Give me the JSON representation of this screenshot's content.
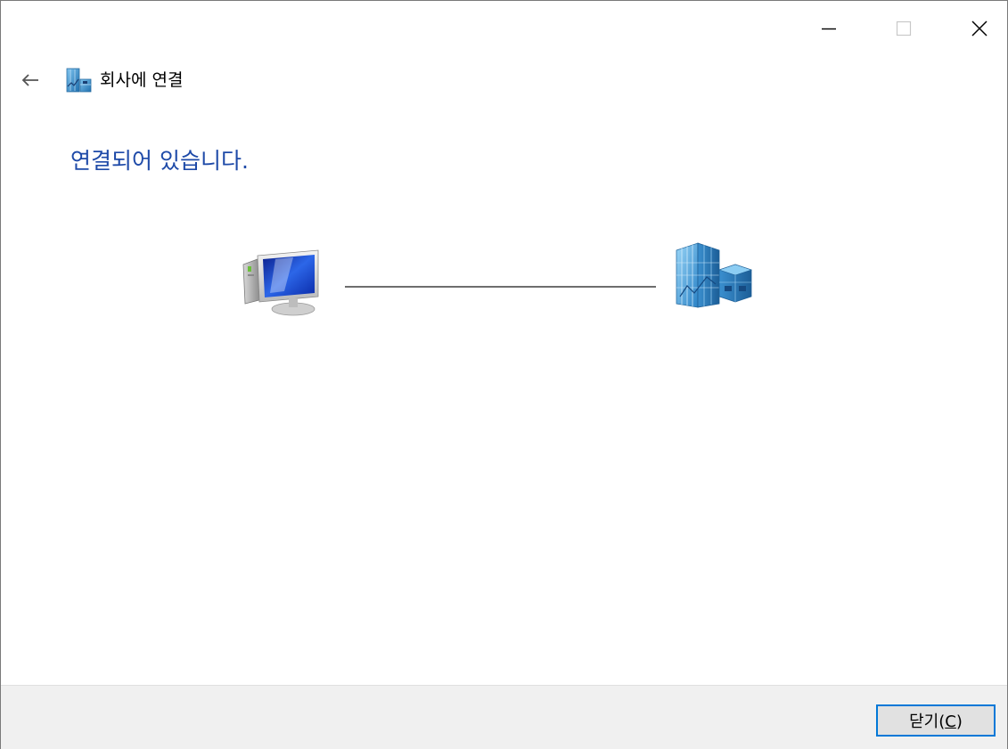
{
  "window": {
    "controls": {
      "minimize_icon": "minimize-icon",
      "maximize_icon": "maximize-icon",
      "close_icon": "close-icon"
    }
  },
  "nav": {
    "back_icon": "back-arrow-icon",
    "app_icon": "workplace-building-icon",
    "title": "회사에 연결"
  },
  "main": {
    "heading": "연결되어 있습니다.",
    "diagram": {
      "left_icon": "computer-icon",
      "right_icon": "workplace-building-icon"
    }
  },
  "footer": {
    "close_button_label": "닫기(",
    "close_button_access_key": "C",
    "close_button_suffix": ")"
  },
  "colors": {
    "heading": "#1e4aa8",
    "focus_border": "#0078d7",
    "footer_bg": "#f0f0f0",
    "line": "#6e6e6e"
  }
}
